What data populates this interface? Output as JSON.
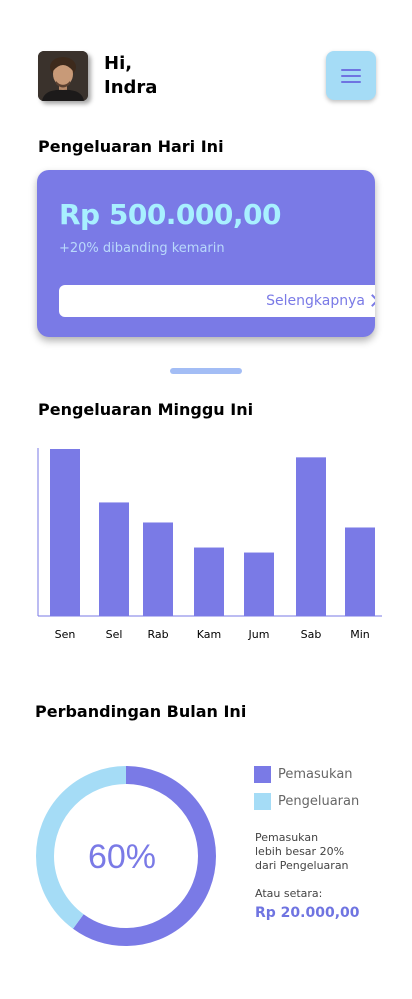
{
  "header": {
    "greeting_line1": "Hi,",
    "greeting_line2": "Indra",
    "avatar_icon": "user-photo",
    "menu_icon": "hamburger-menu-icon"
  },
  "today": {
    "title": "Pengeluaran Hari Ini",
    "amount": "Rp 500.000,00",
    "comparison": "+20% dibanding kemarin",
    "link_label": "Selengkapnya"
  },
  "week": {
    "title": "Pengeluaran Minggu Ini"
  },
  "month": {
    "title": "Perbandingan Bulan Ini",
    "percent_label": "60%",
    "legend": [
      {
        "label": "Pemasukan",
        "color": "#7a7ae6"
      },
      {
        "label": "Pengeluaran",
        "color": "#a5dcf6"
      }
    ],
    "note_lines": [
      "Pemasukan",
      "lebih besar 20%",
      "dari Pengeluaran"
    ],
    "equivalent_label": "Atau setara:",
    "equivalent_value": "Rp 20.000,00"
  },
  "colors": {
    "primary": "#7a7ae6",
    "accent_light": "#a5dcf6"
  },
  "chart_data": [
    {
      "type": "bar",
      "categories": [
        "Sen",
        "Sel",
        "Rab",
        "Kam",
        "Jum",
        "Sab",
        "Min"
      ],
      "values": [
        100,
        68,
        56,
        41,
        38,
        95,
        53
      ],
      "title": "",
      "xlabel": "",
      "ylabel": "",
      "ylim": [
        0,
        100
      ],
      "grid": false,
      "color": "#7a7ae6"
    },
    {
      "type": "pie",
      "categories": [
        "Pemasukan",
        "Pengeluaran"
      ],
      "values": [
        60,
        40
      ],
      "colors": [
        "#7a7ae6",
        "#a5dcf6"
      ],
      "center_label": "60%"
    }
  ]
}
